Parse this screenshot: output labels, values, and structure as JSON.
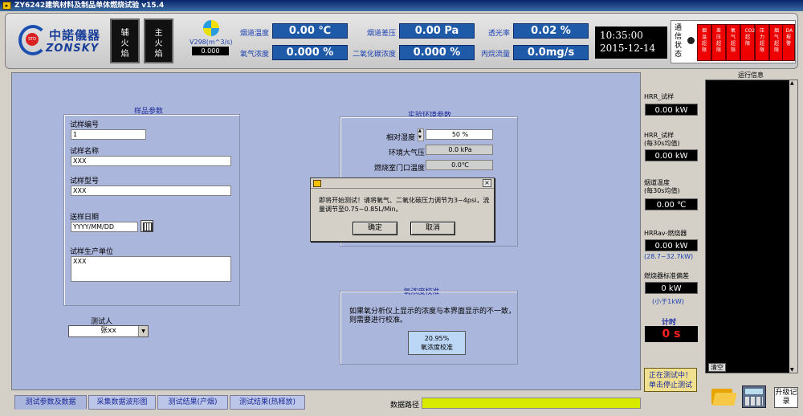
{
  "window": {
    "title": "ZY6242建筑材料及制品单体燃烧试验 v15.4"
  },
  "header": {
    "logo_cn": "中諾儀器",
    "logo_en": "ZONSKY",
    "logo_mark": "STD",
    "aux_flame_label": "辅火焰",
    "main_flame_label": "主火焰",
    "fan_label": "V298(m^3/s)",
    "fan_value": "0.000",
    "measurements": {
      "flue_temp_label": "烟道温度",
      "flue_temp_value": "0.00 ℃",
      "o2_label": "氧气浓度",
      "o2_value": "0.000 %",
      "flue_pressure_label": "烟道差压",
      "flue_pressure_value": "0.00 Pa",
      "co2_label": "二氧化碳浓度",
      "co2_value": "0.000 %",
      "transmittance_label": "透光率",
      "transmittance_value": "0.02 %",
      "propane_label": "丙烷流量",
      "propane_value": "0.0mg/s"
    },
    "clock_time": "10:35:00",
    "clock_date": "2015-12-14",
    "comm_label": "通信状态",
    "alarms": [
      "烟温超限",
      "差压超限",
      "氧气超限",
      "CO2超限",
      "压力超限",
      "烟气超限",
      "DA报警"
    ]
  },
  "sample": {
    "group_title": "样品参数",
    "id_label": "试样编号",
    "id_value": "1",
    "name_label": "试样名称",
    "name_value": "XXX",
    "model_label": "试样型号",
    "model_value": "XXX",
    "date_label": "送样日期",
    "date_value": "YYYY/MM/DD",
    "unit_label": "试样生产单位",
    "unit_value": "XXX",
    "tester_label": "测试人",
    "tester_value": "张xx"
  },
  "env": {
    "group_title": "实验环境参数",
    "humidity_label": "相对湿度",
    "humidity_value": "50 %",
    "pressure_label": "环境大气压",
    "pressure_value": "0.0 kPa",
    "room_temp_label": "燃烧室门口温度",
    "room_temp_value": "0.0℃"
  },
  "o2_cal": {
    "group_title": "氧浓度校准",
    "note": "如果氧分析仪上显示的浓度与本界面显示的不一致，则需要进行校准。",
    "button_value": "20.95%",
    "button_label": "氧浓度校准"
  },
  "dialog": {
    "message": "即将开始测试！请将氧气、二氧化碳压力调节为3~4psi，流量调节至0.75~0.85L/Min。",
    "ok_label": "确定",
    "cancel_label": "取消"
  },
  "tabs": [
    "测试参数及数据",
    "采集数据波形图",
    "测试结果(产烟)",
    "测试结果(热释放)"
  ],
  "data_path_label": "数据路径",
  "info": {
    "hrr_label": "HRR_试样",
    "hrr_value": "0.00 kW",
    "hrr30_label1": "HRR_试样",
    "hrr30_label2": "(每30s均值)",
    "hrr30_value": "0.00 kW",
    "flue30_label1": "烟道温度",
    "flue30_label2": "(每30s均值)",
    "flue30_value": "0.00 ℃",
    "hrrav_label": "HRRav-燃烧器",
    "hrrav_value": "0.00 kW",
    "hrrav_range": "(28.7~32.7kW)",
    "std_label": "燃烧器标准偏差",
    "std_value": "0 kW",
    "std_range": "(小于1kW)",
    "timer_label": "计时",
    "timer_value": "0 s"
  },
  "log": {
    "title": "运行信息",
    "clear_label": "清空"
  },
  "stop_button_line1": "正在测试中！",
  "stop_button_line2": "单击停止测试",
  "upgrade_label": "升级记录"
}
